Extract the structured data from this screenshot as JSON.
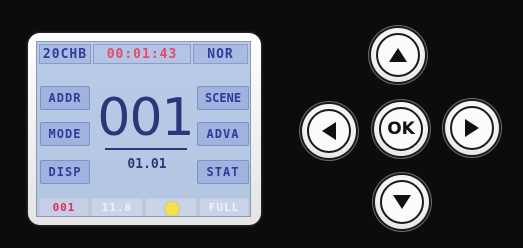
{
  "display": {
    "top": {
      "mode": "20CHB",
      "timer": "00:01:43",
      "status": "NOR"
    },
    "left_buttons": [
      {
        "label": "ADDR"
      },
      {
        "label": "MODE"
      },
      {
        "label": "DISP"
      }
    ],
    "right_buttons": [
      {
        "label": "SCENE"
      },
      {
        "label": "ADVA"
      },
      {
        "label": "STAT"
      }
    ],
    "main_value": "001",
    "sub_value": "01.01",
    "bottom": {
      "address": "001",
      "value": "11.6",
      "indicator": "yellow-dot",
      "state": "FULL"
    }
  },
  "nav": {
    "up": "up-arrow-icon",
    "left": "left-arrow-icon",
    "ok": "OK",
    "right": "right-arrow-icon",
    "down": "down-arrow-icon"
  },
  "colors": {
    "lcd_bg": "#b9cbe6",
    "lcd_text": "#2c3578",
    "timer_red": "#e24a68",
    "bottom_red": "#d9304f",
    "indicator_yellow": "#f3e04a"
  }
}
